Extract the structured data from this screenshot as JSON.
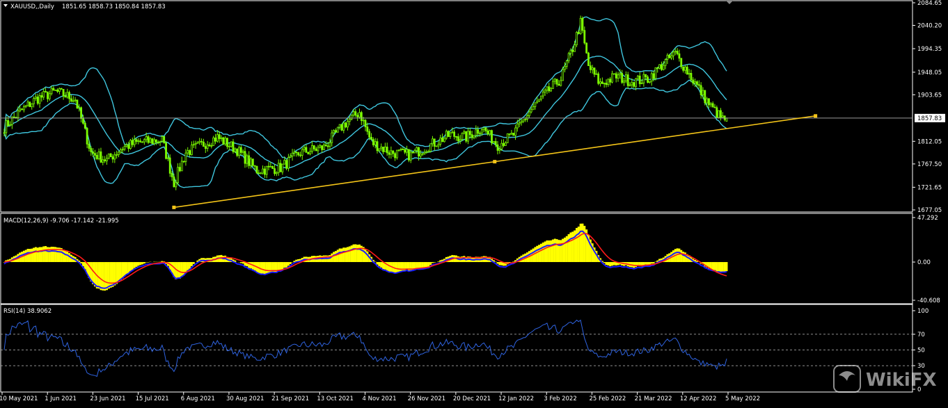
{
  "colors": {
    "background": "#000000",
    "frame": "#ffffff",
    "bull_candle": "#7cfc00",
    "bear_candle": "#7cfc00",
    "bollinger": "#3fc6de",
    "trendline": "#f5c518",
    "price_line": "#9a9a9a",
    "macd_hist": "#ffff00",
    "macd_line": "#1a1aff",
    "signal_line": "#ff1a1a",
    "rsi_line": "#2f63e0",
    "rsi_levels": "#bdbdbd"
  },
  "header": {
    "symbol_label": "XAUUSD,,Daily",
    "ohlc": "1851.65 1858.73 1850.84 1857.83"
  },
  "current_price_label": "1857.83",
  "watermark": {
    "text": "WikiFX",
    "icon": "wikifx-logo-icon"
  },
  "chart_data": [
    {
      "type": "candlestick",
      "title": "XAUUSD,,Daily",
      "ylim": [
        1677.05,
        2084.65
      ],
      "y_ticks": [
        "2084.65",
        "2040.20",
        "1994.35",
        "1948.05",
        "1903.65",
        "1812.05",
        "1767.50",
        "1721.65",
        "1677.05"
      ],
      "x_labels": [
        "10 May 2021",
        "1 Jun 2021",
        "23 Jun 2021",
        "15 Jul 2021",
        "6 Aug 2021",
        "30 Aug 2021",
        "21 Sep 2021",
        "13 Oct 2021",
        "4 Nov 2021",
        "26 Nov 2021",
        "20 Dec 2021",
        "12 Jan 2022",
        "3 Feb 2022",
        "25 Feb 2022",
        "21 Mar 2022",
        "12 Apr 2022",
        "5 May 2022"
      ],
      "last_ohlc": {
        "open": 1851.65,
        "high": 1858.73,
        "low": 1850.84,
        "close": 1857.83
      },
      "close_anchors": [
        [
          0,
          1840
        ],
        [
          8,
          1870
        ],
        [
          16,
          1895
        ],
        [
          26,
          1910
        ],
        [
          36,
          1895
        ],
        [
          44,
          1790
        ],
        [
          52,
          1775
        ],
        [
          60,
          1800
        ],
        [
          68,
          1810
        ],
        [
          80,
          1815
        ],
        [
          86,
          1730
        ],
        [
          92,
          1790
        ],
        [
          100,
          1805
        ],
        [
          108,
          1820
        ],
        [
          118,
          1795
        ],
        [
          128,
          1755
        ],
        [
          140,
          1760
        ],
        [
          150,
          1790
        ],
        [
          162,
          1800
        ],
        [
          172,
          1845
        ],
        [
          180,
          1870
        ],
        [
          186,
          1810
        ],
        [
          196,
          1790
        ],
        [
          206,
          1785
        ],
        [
          216,
          1805
        ],
        [
          226,
          1825
        ],
        [
          234,
          1820
        ],
        [
          242,
          1840
        ],
        [
          250,
          1805
        ],
        [
          258,
          1825
        ],
        [
          266,
          1870
        ],
        [
          274,
          1905
        ],
        [
          282,
          1935
        ],
        [
          288,
          1995
        ],
        [
          292,
          2045
        ],
        [
          296,
          1960
        ],
        [
          302,
          1925
        ],
        [
          310,
          1940
        ],
        [
          318,
          1930
        ],
        [
          326,
          1935
        ],
        [
          334,
          1965
        ],
        [
          340,
          1985
        ],
        [
          346,
          1950
        ],
        [
          352,
          1915
        ],
        [
          358,
          1880
        ],
        [
          364,
          1855
        ],
        [
          366,
          1857.83
        ]
      ],
      "trendline": {
        "start": [
          86,
          1682
        ],
        "end": [
          411,
          1862
        ]
      }
    },
    {
      "type": "line",
      "title": "MACD(12,26,9) -9.706 -17.142 -21.995",
      "ylim": [
        -40.608,
        47.292
      ],
      "y_ticks": [
        "47.292",
        "0.00",
        "-40.608"
      ],
      "series": [
        {
          "name": "MACD(12,26,9)",
          "values": [
            -9.706
          ]
        },
        {
          "name": "Signal",
          "values": [
            -17.142
          ]
        },
        {
          "name": "Histogram",
          "values": [
            -21.995
          ]
        }
      ]
    },
    {
      "type": "line",
      "title": "RSI(14) 38.9062",
      "ylim": [
        0,
        100
      ],
      "y_ticks": [
        "100",
        "70",
        "50",
        "30",
        "0"
      ],
      "levels": [
        70,
        50,
        30
      ],
      "series": [
        {
          "name": "RSI(14)",
          "values": [
            38.9062
          ]
        }
      ]
    }
  ]
}
